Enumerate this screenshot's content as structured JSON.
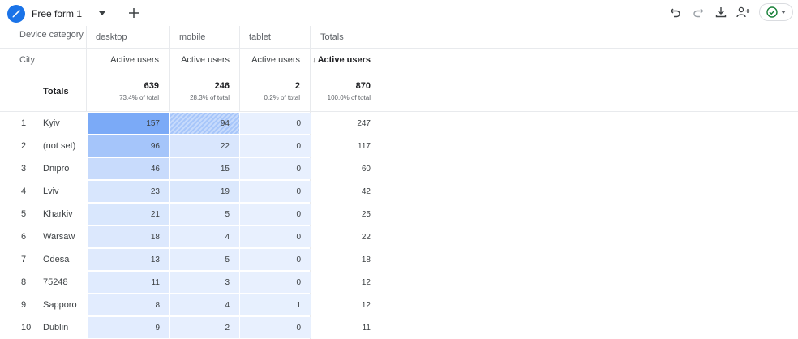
{
  "tab": {
    "title": "Free form 1",
    "add_symbol": "+"
  },
  "colors": {
    "accent": "#1a73e8",
    "heat_max": "#7baaf7",
    "heat_min": "#e8f0fe",
    "status_green": "#188038"
  },
  "header": {
    "dimension_label": "Device category",
    "row_dimension_label": "City",
    "columns": [
      "desktop",
      "mobile",
      "tablet",
      "Totals"
    ],
    "metric_label": "Active users",
    "sorted_metric_label": "Active users",
    "sort_arrow": "↓"
  },
  "totals": {
    "label": "Totals",
    "values": [
      {
        "value": "639",
        "pct": "73.4% of total"
      },
      {
        "value": "246",
        "pct": "28.3% of total"
      },
      {
        "value": "2",
        "pct": "0.2% of total"
      },
      {
        "value": "870",
        "pct": "100.0% of total"
      }
    ]
  },
  "rows": [
    {
      "idx": "1",
      "city": "Kyiv",
      "desktop": "157",
      "mobile": "94",
      "tablet": "0",
      "total": "247"
    },
    {
      "idx": "2",
      "city": "(not set)",
      "desktop": "96",
      "mobile": "22",
      "tablet": "0",
      "total": "117"
    },
    {
      "idx": "3",
      "city": "Dnipro",
      "desktop": "46",
      "mobile": "15",
      "tablet": "0",
      "total": "60"
    },
    {
      "idx": "4",
      "city": "Lviv",
      "desktop": "23",
      "mobile": "19",
      "tablet": "0",
      "total": "42"
    },
    {
      "idx": "5",
      "city": "Kharkiv",
      "desktop": "21",
      "mobile": "5",
      "tablet": "0",
      "total": "25"
    },
    {
      "idx": "6",
      "city": "Warsaw",
      "desktop": "18",
      "mobile": "4",
      "tablet": "0",
      "total": "22"
    },
    {
      "idx": "7",
      "city": "Odesa",
      "desktop": "13",
      "mobile": "5",
      "tablet": "0",
      "total": "18"
    },
    {
      "idx": "8",
      "city": "75248",
      "desktop": "11",
      "mobile": "3",
      "tablet": "0",
      "total": "12"
    },
    {
      "idx": "9",
      "city": "Sapporo",
      "desktop": "8",
      "mobile": "4",
      "tablet": "1",
      "total": "12"
    },
    {
      "idx": "10",
      "city": "Dublin",
      "desktop": "9",
      "mobile": "2",
      "tablet": "0",
      "total": "11"
    }
  ]
}
